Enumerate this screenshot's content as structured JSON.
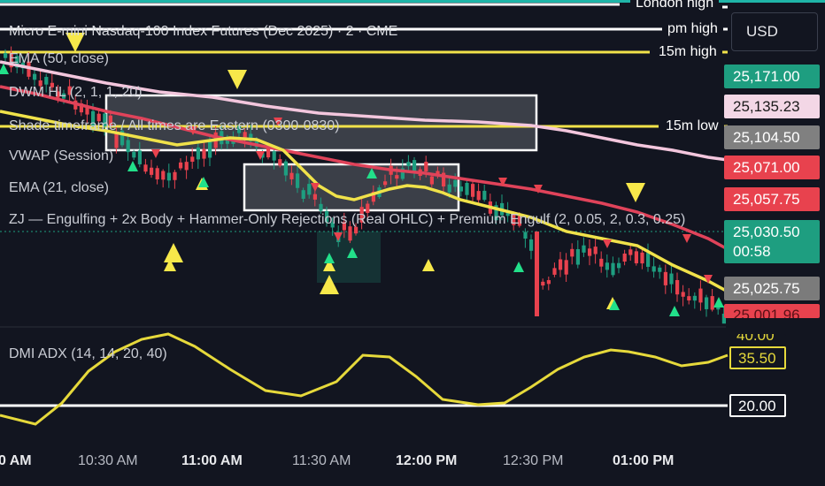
{
  "chart": {
    "title": "Micro E-mini Nasdaq-100 Index Futures (Dec 2025) · 2 · CME",
    "currency_button": "USD",
    "indicators": [
      "EMA (50, close)",
      "DWM HL (2, 1, 1, 20)",
      "Shade timeframe / All times are Eastern (0300-0830)",
      "VWAP (Session)",
      "EMA (21, close)",
      "ZJ — Engulfing + 2x Body + Hammer-Only Rejections (Real OHLC) + Premium Engulf (2, 0.05, 2, 0.3, 0.25)"
    ],
    "sub_indicator": "DMI ADX (14, 14, 20, 40)",
    "level_labels": {
      "london_high": "London high",
      "pm_high": "pm high",
      "m15_high": "15m high",
      "m15_low": "15m low"
    },
    "price_tags": [
      {
        "text": "25,171.00",
        "bg": "#1e9e80",
        "fg": "#ffffff"
      },
      {
        "text": "25,135.23",
        "bg": "#f3d7e6",
        "fg": "#1a1a1a"
      },
      {
        "text": "25,104.50",
        "bg": "#808080",
        "fg": "#ffffff"
      },
      {
        "text": "25,071.00",
        "bg": "#e8424e",
        "fg": "#ffffff"
      },
      {
        "text": "25,057.75",
        "bg": "#e8424e",
        "fg": "#ffffff"
      },
      {
        "text": "25,030.50",
        "bg": "#1e9e80",
        "fg": "#ffffff"
      },
      {
        "text": "00:58",
        "bg": "#1e9e80",
        "fg": "#ffffff"
      },
      {
        "text": "25,025.75",
        "bg": "#7b7b7b",
        "fg": "#ffffff"
      },
      {
        "text": "25,001.96",
        "bg": "#e8424e",
        "fg": "#5a1016"
      }
    ],
    "adx_tags": {
      "upper": "40.00",
      "value": "35.50",
      "lower": "20.00"
    },
    "time_axis": [
      {
        "text": "0 AM",
        "bold": true
      },
      {
        "text": "10:30 AM",
        "bold": false
      },
      {
        "text": "11:00 AM",
        "bold": true
      },
      {
        "text": "11:30 AM",
        "bold": false
      },
      {
        "text": "12:00 PM",
        "bold": true
      },
      {
        "text": "12:30 PM",
        "bold": false
      },
      {
        "text": "01:00 PM",
        "bold": true
      }
    ],
    "colors": {
      "background": "#121520",
      "bull": "#1e9e80",
      "bear": "#e8424e",
      "ema21": "#f0e24a",
      "ema50": "#e0435a",
      "vwap": "#f3c6dd",
      "level_yellow": "#f1e24a",
      "signal_yellow": "#f7e84a",
      "signal_green": "#22e08a",
      "adx": "#e6d93b"
    }
  }
}
